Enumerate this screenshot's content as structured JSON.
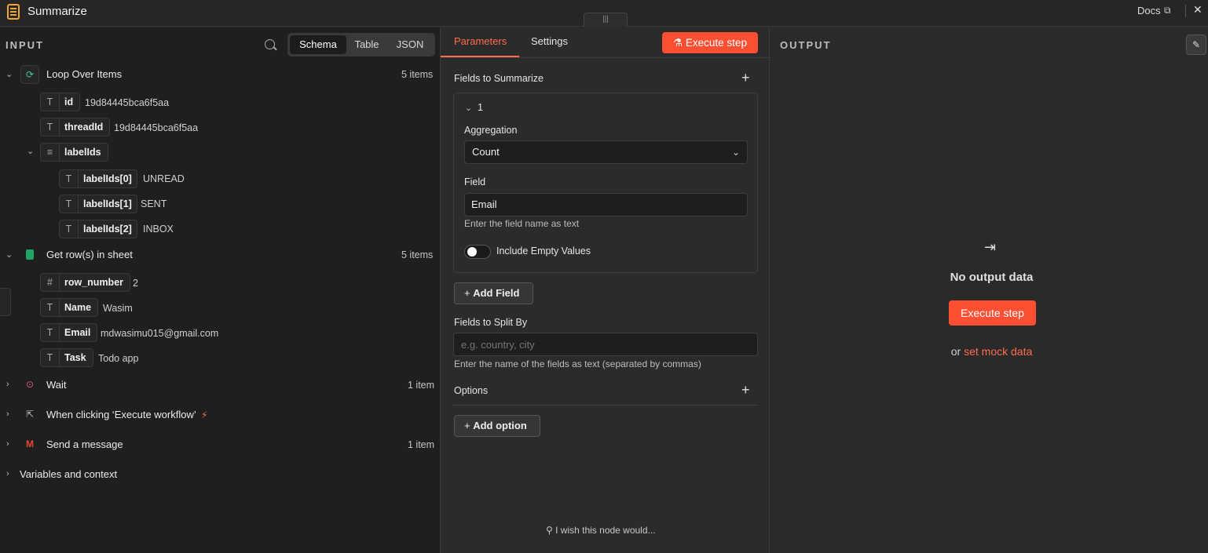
{
  "header": {
    "title": "Summarize",
    "docs_label": "Docs",
    "close_label": "✕"
  },
  "input": {
    "label": "INPUT",
    "view_tabs": [
      "Schema",
      "Table",
      "JSON"
    ],
    "active_view": "Schema",
    "nodes": [
      {
        "name": "Loop Over Items",
        "count": "5 items",
        "icon": "loop-icon",
        "fields": [
          {
            "type": "T",
            "key": "id",
            "value": "19d84445bca6f5aa"
          },
          {
            "type": "T",
            "key": "threadId",
            "value": "19d84445bca6f5aa"
          },
          {
            "type": "≡",
            "key": "labelIds",
            "value": ""
          },
          {
            "type": "T",
            "key": "labelIds[0]",
            "value": "UNREAD"
          },
          {
            "type": "T",
            "key": "labelIds[1]",
            "value": "SENT"
          },
          {
            "type": "T",
            "key": "labelIds[2]",
            "value": "INBOX"
          }
        ]
      },
      {
        "name": "Get row(s) in sheet",
        "count": "5 items",
        "icon": "google-sheets-icon",
        "fields": [
          {
            "type": "#",
            "key": "row_number",
            "value": "2"
          },
          {
            "type": "T",
            "key": "Name",
            "value": "Wasim"
          },
          {
            "type": "T",
            "key": "Email",
            "value": "mdwasimu015@gmail.com"
          },
          {
            "type": "T",
            "key": "Task",
            "value": "Todo app"
          }
        ]
      },
      {
        "name": "Wait",
        "count": "1 item",
        "icon": "wait-icon"
      },
      {
        "name": "When clicking ‘Execute workflow’",
        "count": "",
        "icon": "cursor-icon"
      },
      {
        "name": "Send a message",
        "count": "1 item",
        "icon": "gmail-icon"
      },
      {
        "name": "Variables and context",
        "count": "",
        "icon": ""
      }
    ]
  },
  "params": {
    "tabs": [
      "Parameters",
      "Settings"
    ],
    "execute_label": "Execute step",
    "fields_to_summarize": "Fields to Summarize",
    "item_index": "1",
    "aggregation_label": "Aggregation",
    "aggregation_value": "Count",
    "field_label": "Field",
    "field_value": "Email",
    "field_hint": "Enter the field name as text",
    "include_empty_label": "Include Empty Values",
    "include_empty_value": false,
    "add_field_label": "Add Field",
    "split_by_label": "Fields to Split By",
    "split_by_placeholder": "e.g. country, city",
    "split_by_hint": "Enter the name of the fields as text (separated by commas)",
    "options_label": "Options",
    "add_option_label": "Add option",
    "footer": "I wish this node would..."
  },
  "output": {
    "label": "OUTPUT",
    "empty_title": "No output data",
    "execute_label": "Execute step",
    "or_text": "or",
    "mock_link": "set mock data"
  },
  "colors": {
    "accent": "#ff6d4d",
    "primary_button": "#ff4f33",
    "sheets_green": "#21a366",
    "loop_teal": "#3ec7a8"
  }
}
